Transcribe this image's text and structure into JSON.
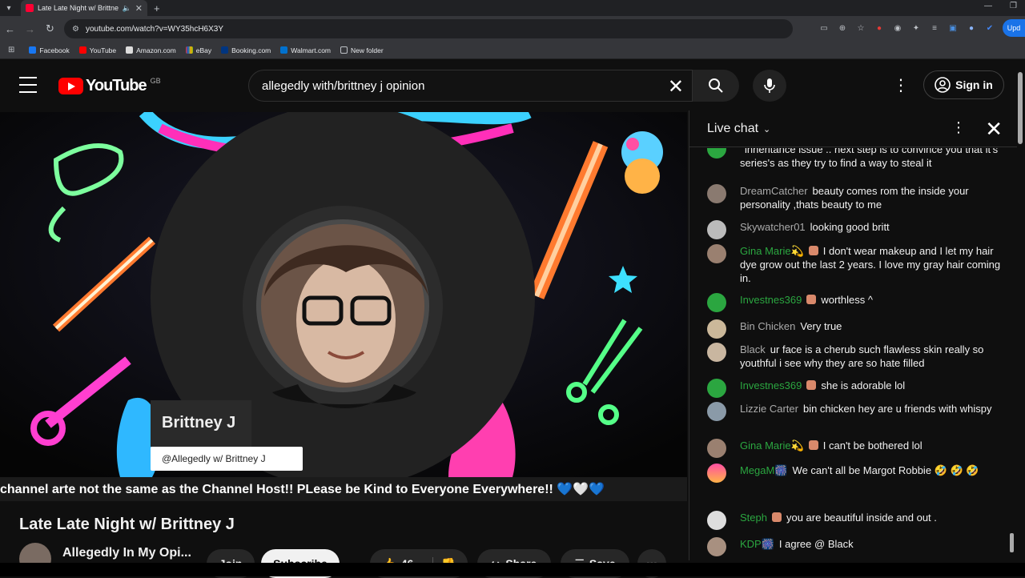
{
  "browser": {
    "tab_title": "Late Late Night w/ Brittney",
    "url": "youtube.com/watch?v=WY35hcH6X3Y",
    "update_label": "Upd",
    "bookmarks": [
      "Facebook",
      "YouTube",
      "Amazon.com",
      "eBay",
      "Booking.com",
      "Walmart.com",
      "New folder"
    ]
  },
  "youtube": {
    "logo_text": "YouTube",
    "region": "GB",
    "search_value": "allegedly with/brittney j opinion",
    "signin_label": "Sign in"
  },
  "video": {
    "overlay_name": "Brittney J",
    "overlay_handle": "@Allegedly w/ Brittney J",
    "ticker_text": "channel arte not the same as the Channel Host!! PLease be Kind to Everyone Everywhere!! 💙🤍💙",
    "title": "Late Late Night w/ Brittney J",
    "channel_name": "Allegedly In My Opi...",
    "join_label": "Join",
    "subscribe_label": "Subscribe",
    "likes": "46",
    "share_label": "Share",
    "save_label": "Save"
  },
  "chat": {
    "title": "Live chat",
    "messages": [
      {
        "author": "",
        "text": "inheritance issue .. next step is to convince you that it's series's as they try to find a way to steal it",
        "color": "green"
      },
      {
        "author": "DreamCatcher",
        "text": "beauty comes rom the inside your personality ,thats beauty to me",
        "color": "grey"
      },
      {
        "author": "Skywatcher01",
        "text": "looking good britt",
        "color": "grey"
      },
      {
        "author": "Gina Marie💫",
        "text": "I don't wear makeup and I let my hair dye grow out the last 2 years. I love my gray hair coming in.",
        "color": "green"
      },
      {
        "author": "Investnes369",
        "text": "worthless ^",
        "color": "green"
      },
      {
        "author": "Bin Chicken",
        "text": "Very true",
        "color": "grey"
      },
      {
        "author": "Black",
        "text": "ur face is a cherub such flawless skin really so youthful i see why they are so hate filled",
        "color": "grey"
      },
      {
        "author": "Investnes369",
        "text": "she is adorable lol",
        "color": "green"
      },
      {
        "author": "Lizzie Carter",
        "text": "bin chicken hey are u friends with whispy",
        "color": "grey"
      },
      {
        "author": "Gina Marie💫",
        "text": "I can't be bothered lol",
        "color": "green"
      },
      {
        "author": "MegaM🎆",
        "text": "We can't all be Margot Robbie 🤣 🤣 🤣",
        "color": "green"
      },
      {
        "author": "Steph",
        "text": "you are beautiful inside and out .",
        "color": "green"
      },
      {
        "author": "KDP🎆",
        "text": "I agree @ Black",
        "color": "green"
      }
    ]
  }
}
